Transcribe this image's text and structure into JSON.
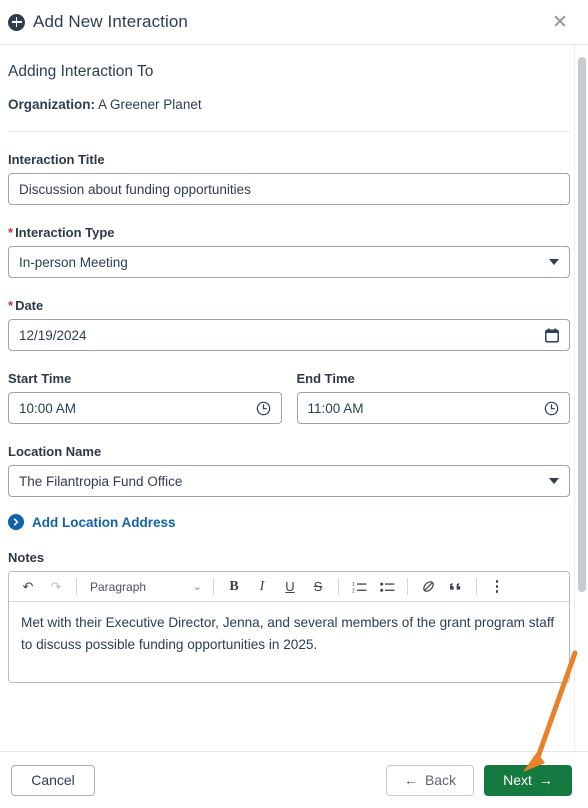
{
  "header": {
    "title": "Add New Interaction",
    "add_icon": "plus-circle-icon",
    "close_label": "✕"
  },
  "body": {
    "section_title": "Adding Interaction To",
    "organization_label": "Organization:",
    "organization_value": "A Greener Planet"
  },
  "fields": {
    "interaction_title": {
      "label": "Interaction Title",
      "value": "Discussion about funding opportunities",
      "required": false
    },
    "interaction_type": {
      "label": "Interaction Type",
      "value": "In-person Meeting",
      "required": true,
      "required_mark": "*"
    },
    "date": {
      "label": "Date",
      "value": "12/19/2024",
      "required": true,
      "required_mark": "*",
      "icon": "calendar-icon"
    },
    "start_time": {
      "label": "Start Time",
      "value": "10:00 AM",
      "icon": "clock-icon"
    },
    "end_time": {
      "label": "End Time",
      "value": "11:00 AM",
      "icon": "clock-icon"
    },
    "location_name": {
      "label": "Location Name",
      "value": "The Filantropia Fund Office"
    },
    "add_location_address": {
      "label": "Add Location Address",
      "icon": "chevron-right-circle-icon"
    },
    "notes": {
      "label": "Notes",
      "content": "Met with their Executive Director, Jenna, and several members of the grant program staff to discuss possible funding opportunities in 2025."
    }
  },
  "editor_toolbar": {
    "undo": "↶",
    "redo": "↷",
    "block_format": "Paragraph",
    "block_caret": "⌄",
    "bold": "B",
    "italic": "I",
    "underline": "U",
    "strikethrough": "S",
    "ordered_list": "ordered-list-icon",
    "bullet_list": "bullet-list-icon",
    "link": "link-icon",
    "blockquote": "“",
    "more": "more-options-icon"
  },
  "footer": {
    "cancel": "Cancel",
    "back": "Back",
    "back_arrow": "←",
    "next": "Next",
    "next_arrow": "→"
  },
  "colors": {
    "accent_blue": "#1262a8",
    "next_green": "#16793f",
    "required_red": "#c0392b",
    "text_navy": "#2c3e50",
    "annotation_orange": "#e8822a"
  }
}
